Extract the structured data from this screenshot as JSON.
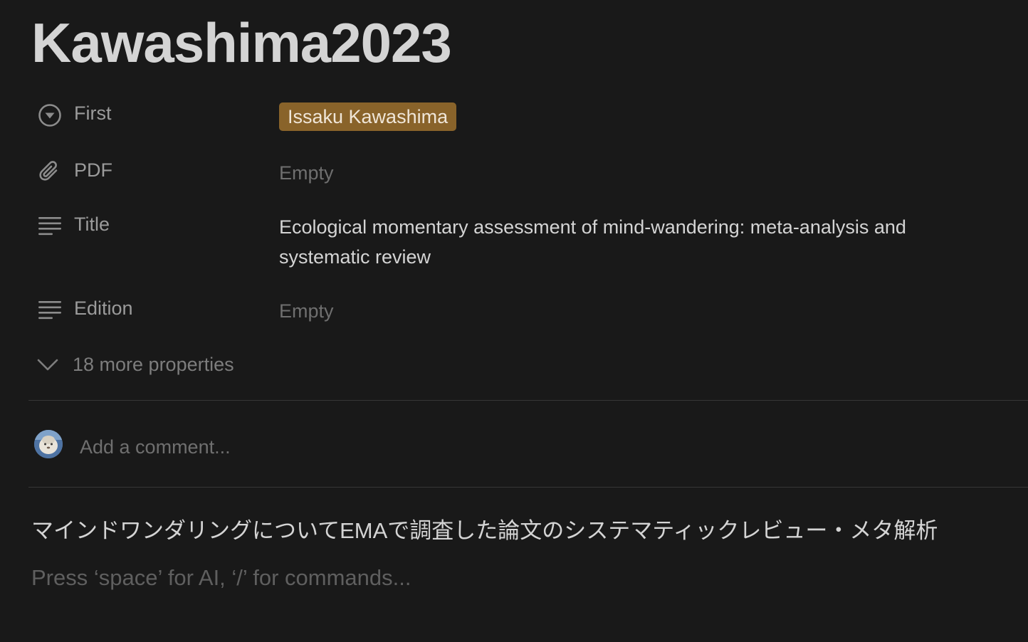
{
  "page": {
    "title": "Kawashima2023"
  },
  "properties": [
    {
      "icon": "select-icon",
      "label": "First",
      "value": "Issaku Kawashima",
      "type": "tag",
      "tag_color": "#89632a"
    },
    {
      "icon": "paperclip-icon",
      "label": "PDF",
      "value": "Empty",
      "type": "empty"
    },
    {
      "icon": "text-lines-icon",
      "label": "Title",
      "value": "Ecological momentary assessment of mind-wandering: meta-analysis and systematic review",
      "type": "text"
    },
    {
      "icon": "text-lines-icon",
      "label": "Edition",
      "value": "Empty",
      "type": "empty"
    }
  ],
  "more_properties": {
    "icon": "chevron-down-icon",
    "label": "18 more properties"
  },
  "comment": {
    "placeholder": "Add a comment..."
  },
  "body": {
    "text": "マインドワンダリングについてEMAで調査した論文のシステマティックレビュー・メタ解析",
    "placeholder": "Press ‘space’ for AI, ‘/’ for commands..."
  },
  "colors": {
    "background": "#191919",
    "text": "#d4d4d4",
    "muted": "#9b9b9b",
    "tag": "#89632a"
  }
}
